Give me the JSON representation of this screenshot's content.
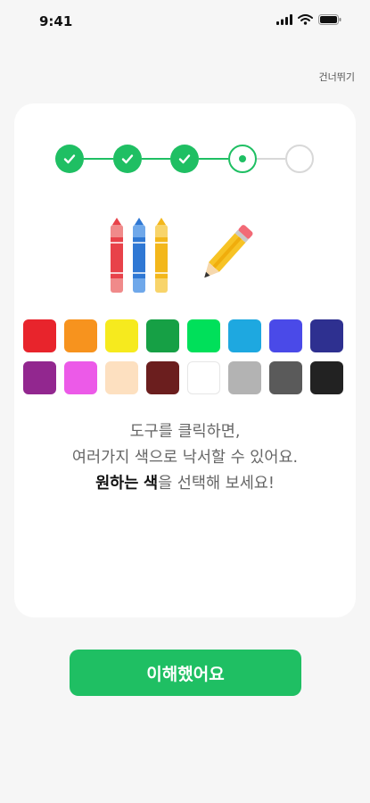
{
  "status_bar": {
    "time": "9:41"
  },
  "header": {
    "skip_label": "건너뛰기"
  },
  "stepper": {
    "total_steps": 5,
    "current_step": 4,
    "states": [
      "done",
      "done",
      "done",
      "current",
      "todo"
    ],
    "active_color": "#1fbf63",
    "inactive_color": "#d8d8d8"
  },
  "illustration": {
    "icons": [
      "crayon-red-icon",
      "crayon-blue-icon",
      "crayon-yellow-icon",
      "pencil-icon"
    ]
  },
  "palette": {
    "colors": [
      "#e8242c",
      "#f7931e",
      "#f6ea1e",
      "#16a045",
      "#00e05a",
      "#1ea8e0",
      "#4a4ae8",
      "#2e3090",
      "#92278f",
      "#ec5ae8",
      "#fde0c0",
      "#6b1e1e",
      "#ffffff",
      "#b3b3b3",
      "#5a5a5a",
      "#222222"
    ]
  },
  "message": {
    "line1": "도구를 클릭하면,",
    "line2": "여러가지 색으로 낙서할 수 있어요.",
    "line3_strong1": "원하는",
    "line3_space": " ",
    "line3_strong2": "색",
    "line3_rest": "을 선택해 보세요!"
  },
  "confirm_button": {
    "label": "이해했어요"
  }
}
